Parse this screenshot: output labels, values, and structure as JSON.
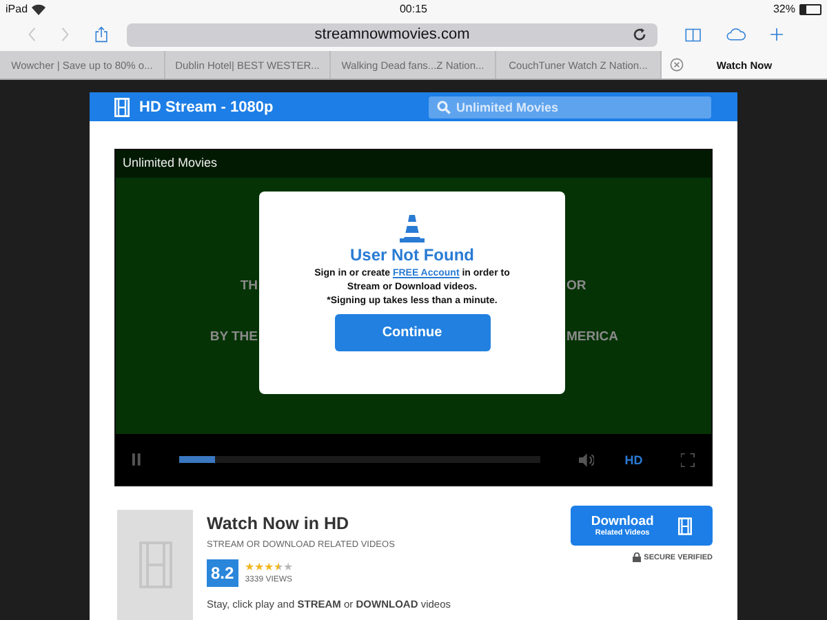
{
  "status_bar": {
    "device": "iPad",
    "time": "00:15",
    "battery": "32%"
  },
  "address_bar": {
    "url": "streamnowmovies.com"
  },
  "tabs": [
    {
      "label": "Wowcher | Save up to 80% o...",
      "selected": false
    },
    {
      "label": "Dublin Hotel| BEST WESTER...",
      "selected": false
    },
    {
      "label": "Walking Dead fans...Z Nation...",
      "selected": false
    },
    {
      "label": "CouchTuner Watch Z Nation...",
      "selected": false
    },
    {
      "label": "Watch Now",
      "selected": true
    }
  ],
  "site_header": {
    "title": "HD Stream - 1080p",
    "search_placeholder": "Unlimited Movies"
  },
  "player": {
    "title": "Unlimited Movies",
    "behind_text": [
      {
        "left": "TH",
        "right": "OR"
      },
      {
        "left": "BY THE",
        "right": "MERICA"
      }
    ],
    "quality": "HD",
    "progress": {
      "level": 0.1
    }
  },
  "modal": {
    "title": "User Not Found",
    "message_before": "Sign in or create",
    "link": "FREE Account",
    "message_after": "in order to",
    "message_2": "Stream or Download videos.",
    "note": "*Signing up takes less than a minute.",
    "button": "Continue"
  },
  "video_info": {
    "title": "Watch Now in HD",
    "subtitle": "STREAM OR DOWNLOAD RELATED VIDEOS",
    "rating": "8.2",
    "stars": 3.5,
    "views": "3339 VIEWS",
    "description": "Stay, click play and **STREAM** or **DOWNLOAD** videos",
    "download_button": {
      "label": "Download",
      "sublabel": "Related Videos"
    },
    "secure": "SECURE VERIFIED"
  }
}
